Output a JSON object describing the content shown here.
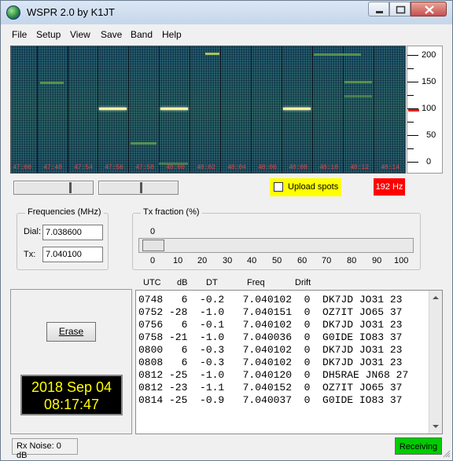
{
  "window": {
    "title": "WSPR 2.0    by K1JT",
    "buttons": [
      "minimize-icon",
      "maximize-icon",
      "close-icon"
    ]
  },
  "menu": [
    "File",
    "Setup",
    "View",
    "Save",
    "Band",
    "Help"
  ],
  "waterfall": {
    "time_labels": [
      "47:00",
      "47:48",
      "47:54",
      "47:56",
      "47:58",
      "48:00",
      "48:02",
      "48:04",
      "48:06",
      "48:08",
      "48:10",
      "48:12",
      "48:14"
    ],
    "scale_labels": [
      "200",
      "150",
      "100",
      "50",
      "0"
    ]
  },
  "upload_spots": {
    "label": "Upload spots",
    "checked": false
  },
  "tx_offset": "192 Hz",
  "frequencies": {
    "title": "Frequencies (MHz)",
    "dial_label": "Dial:",
    "dial_value": "7.038600",
    "tx_label": "Tx:",
    "tx_value": "7.040100"
  },
  "tx_fraction": {
    "title": "Tx fraction (%)",
    "value_label": "0",
    "value_percent": 0,
    "ticks": [
      "0",
      "10",
      "20",
      "30",
      "40",
      "50",
      "60",
      "70",
      "80",
      "90",
      "100"
    ]
  },
  "columns": {
    "utc": "UTC",
    "db": "dB",
    "dt": "DT",
    "freq": "Freq",
    "drift": "Drift"
  },
  "decodes": [
    "0748   6  -0.2   7.040102  0  DK7JD JO31 23",
    "0752 -28  -1.0   7.040151  0  OZ7IT JO65 37",
    "0756   6  -0.1   7.040102  0  DK7JD JO31 23",
    "0758 -21  -1.0   7.040036  0  G0IDE IO83 37",
    "0800   6  -0.3   7.040102  0  DK7JD JO31 23",
    "0808   6  -0.3   7.040102  0  DK7JD JO31 23",
    "0812 -25  -1.0   7.040120  0  DH5RAE JN68 27",
    "0812 -23  -1.1   7.040152  0  OZ7IT JO65 37",
    "0814 -25  -0.9   7.040037  0  G0IDE IO83 37"
  ],
  "erase_label": "Erase",
  "clock": {
    "date": "2018 Sep 04",
    "time": "08:17:47"
  },
  "status": {
    "rx_noise": "Rx Noise: 0 dB",
    "state": "Receiving"
  },
  "colors": {
    "upload_bg": "#ffff00",
    "offset_bg": "#ff0000",
    "receiving_bg": "#00cc00",
    "clock_text": "#ffff00"
  }
}
